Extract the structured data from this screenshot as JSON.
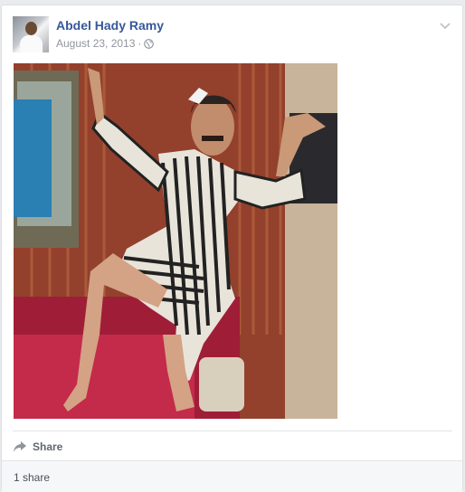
{
  "post": {
    "author": "Abdel Hady Ramy",
    "date": "August 23, 2013",
    "separator": "·",
    "privacy_icon": "globe-icon",
    "menu_icon": "chevron-down-icon",
    "photo": "person in striped dress posing on red sofa",
    "actions": {
      "share_label": "Share",
      "share_icon": "share-arrow-icon"
    },
    "footer": {
      "share_count": "1 share"
    }
  }
}
